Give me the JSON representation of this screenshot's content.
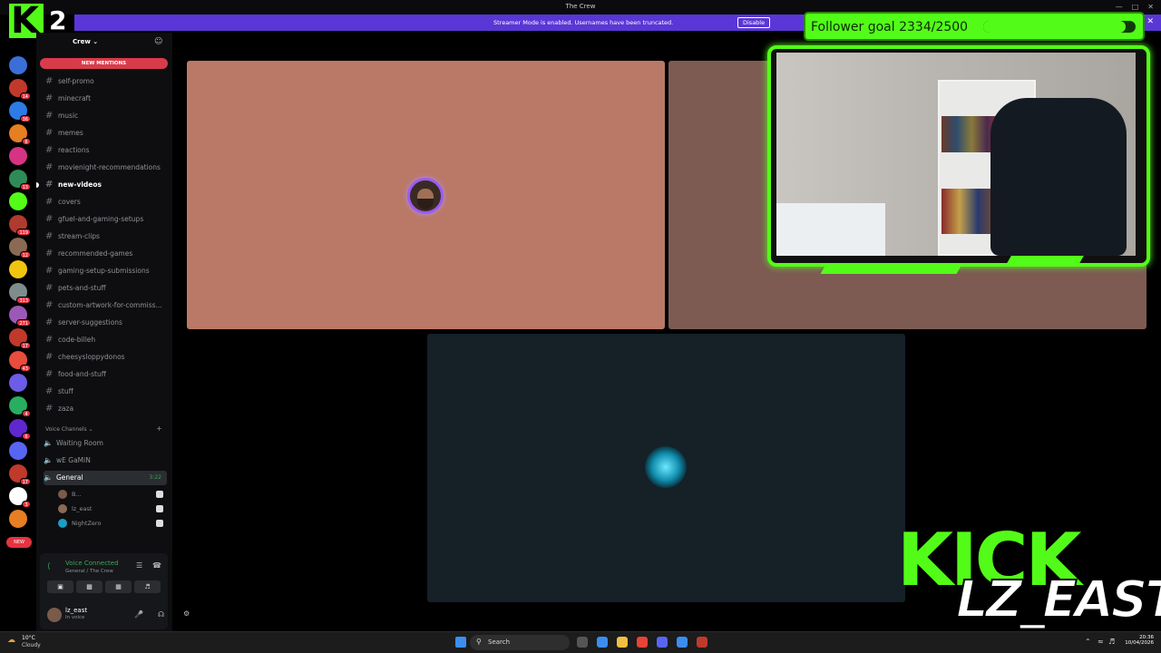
{
  "window": {
    "title": "The Crew"
  },
  "banner": {
    "message": "Streamer Mode is enabled. Usernames have been truncated.",
    "disable_label": "Disable"
  },
  "overlay": {
    "kick_logo_letter": "K",
    "kick_logo_number": "2",
    "follower_goal_text": "Follower goal 2334/2500",
    "follower_goal_current": 2334,
    "follower_goal_target": 2500,
    "kick_text": "KICK",
    "streamer_name": "LZ_EAST",
    "brand_color": "#53fc18"
  },
  "rail": {
    "servers": [
      {
        "color": "#3b6fd8",
        "badge": ""
      },
      {
        "color": "#c0392b",
        "badge": "14"
      },
      {
        "color": "#2d7be5",
        "badge": "36"
      },
      {
        "color": "#e67e22",
        "badge": "6"
      },
      {
        "color": "#d63384",
        "badge": ""
      },
      {
        "color": "#2e8b57",
        "badge": "13"
      },
      {
        "color": "#53fc18",
        "badge": ""
      },
      {
        "color": "#b03a2e",
        "badge": "119"
      },
      {
        "color": "#8a6a55",
        "badge": "12"
      },
      {
        "color": "#f1c40f",
        "badge": ""
      },
      {
        "color": "#7f8c8d",
        "badge": "313"
      },
      {
        "color": "#9b59b6",
        "badge": "271"
      },
      {
        "color": "#c0392b",
        "badge": "17"
      },
      {
        "color": "#e74c3c",
        "badge": "43"
      },
      {
        "color": "#6c5ce7",
        "badge": ""
      },
      {
        "color": "#27ae60",
        "badge": "4"
      },
      {
        "color": "#5f27cd",
        "badge": "6"
      },
      {
        "color": "#5865f2",
        "badge": ""
      },
      {
        "color": "#c0392b",
        "badge": "17"
      },
      {
        "color": "#ffffff",
        "badge": "3"
      },
      {
        "color": "#e67e22",
        "badge": ""
      }
    ],
    "new_label": "NEW"
  },
  "sidebar": {
    "server_name": "Crew",
    "new_mentions": "NEW MENTIONS",
    "channels": [
      {
        "name": "self-promo",
        "unread": false
      },
      {
        "name": "minecraft",
        "unread": false
      },
      {
        "name": "music",
        "unread": false
      },
      {
        "name": "memes",
        "unread": false
      },
      {
        "name": "reactions",
        "unread": false
      },
      {
        "name": "movienight-recommendations",
        "unread": false
      },
      {
        "name": "new-videos",
        "unread": true
      },
      {
        "name": "covers",
        "unread": false
      },
      {
        "name": "gfuel-and-gaming-setups",
        "unread": false
      },
      {
        "name": "stream-clips",
        "unread": false
      },
      {
        "name": "recommended-games",
        "unread": false
      },
      {
        "name": "gaming-setup-submissions",
        "unread": false
      },
      {
        "name": "pets-and-stuff",
        "unread": false
      },
      {
        "name": "custom-artwork-for-commiss...",
        "unread": false
      },
      {
        "name": "server-suggestions",
        "unread": false
      },
      {
        "name": "code-billeh",
        "unread": false
      },
      {
        "name": "cheesysloppydonos",
        "unread": false
      },
      {
        "name": "food-and-stuff",
        "unread": false
      },
      {
        "name": "stuff",
        "unread": false
      },
      {
        "name": "zaza",
        "unread": false
      }
    ],
    "voice_category": "Voice Channels",
    "voice_channels": [
      {
        "name": "Waiting Room",
        "active": false,
        "timer": ""
      },
      {
        "name": "wE GaMiN",
        "active": false,
        "timer": ""
      },
      {
        "name": "General",
        "active": true,
        "timer": "3:22"
      }
    ],
    "voice_users": [
      {
        "name": "B...",
        "avatar_color": "#7a5b4a"
      },
      {
        "name": "lz_east",
        "avatar_color": "#8a6a55"
      },
      {
        "name": "NightZero",
        "avatar_color": "#1a9fc4"
      }
    ]
  },
  "voice_panel": {
    "status": "Voice Connected",
    "location": "General / The Crew"
  },
  "user_bar": {
    "username": "lz_east",
    "status": "In voice"
  },
  "taskbar": {
    "temperature": "10°C",
    "condition": "Cloudy",
    "search_placeholder": "Search",
    "time": "20:36",
    "date": "10/04/2026"
  }
}
